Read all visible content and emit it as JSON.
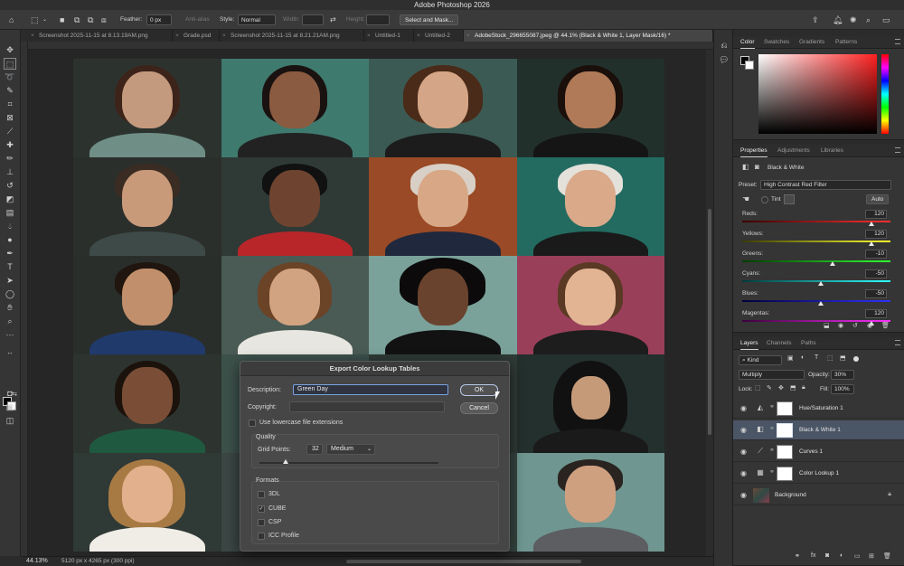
{
  "app": {
    "title": "Adobe Photoshop 2026"
  },
  "options_bar": {
    "feather_label": "Feather:",
    "feather_value": "0 px",
    "antialias_label": "Anti-alias",
    "style_label": "Style:",
    "style_value": "Normal",
    "width_label": "Width:",
    "height_label": "Height:",
    "select_mask_label": "Select and Mask..."
  },
  "doc_tabs": [
    {
      "label": "Screenshot 2025-11-15 at 8.13.19AM.png"
    },
    {
      "label": "Grade.psd"
    },
    {
      "label": "Screenshot 2025-11-15 at 8.21.21AM.png"
    },
    {
      "label": "Untitled-1"
    },
    {
      "label": "Untitled-2"
    },
    {
      "label": "AdobeStock_296655087.jpeg @ 44.1% (Black & White 1, Layer Mask/16) *"
    }
  ],
  "status": {
    "zoom": "44.13%",
    "info": "5120 px x 4265 px (300 ppi)"
  },
  "color_panel": {
    "tabs": [
      "Color",
      "Swatches",
      "Gradients",
      "Patterns"
    ],
    "foreground": "#000000",
    "background": "#ffffff"
  },
  "properties": {
    "tabs": [
      "Properties",
      "Adjustments",
      "Libraries"
    ],
    "adjustment_name": "Black & White",
    "preset_label": "Preset:",
    "preset_value": "High Contrast Red Filter",
    "tint_label": "Tint",
    "auto_label": "Auto",
    "sliders": [
      {
        "label": "Reds:",
        "value": "120",
        "pos": 0.87
      },
      {
        "label": "Yellows:",
        "value": "120",
        "pos": 0.87
      },
      {
        "label": "Greens:",
        "value": "-10",
        "pos": 0.61
      },
      {
        "label": "Cyans:",
        "value": "-50",
        "pos": 0.53
      },
      {
        "label": "Blues:",
        "value": "-50",
        "pos": 0.53
      },
      {
        "label": "Magentas:",
        "value": "120",
        "pos": 0.87
      }
    ]
  },
  "layers_panel": {
    "tabs": [
      "Layers",
      "Channels",
      "Paths"
    ],
    "filter_value": "Kind",
    "blend_mode": "Multiply",
    "opacity_label": "Opacity:",
    "opacity_value": "30%",
    "lock_label": "Lock:",
    "fill_label": "Fill:",
    "fill_value": "100%",
    "layers": [
      {
        "name": "Hue/Saturation 1",
        "selected": false
      },
      {
        "name": "Black & White 1",
        "selected": true
      },
      {
        "name": "Curves 1",
        "selected": false
      },
      {
        "name": "Color Lookup 1",
        "selected": false
      },
      {
        "name": "Background",
        "selected": false
      }
    ]
  },
  "dialog": {
    "title": "Export Color Lookup Tables",
    "description_label": "Description:",
    "description_value": "Green Day",
    "copyright_label": "Copyright:",
    "copyright_value": "",
    "ok_label": "OK",
    "cancel_label": "Cancel",
    "lowercase_label": "Use lowercase file extensions",
    "lowercase_checked": false,
    "quality_label": "Quality",
    "grid_points_label": "Grid Points:",
    "grid_points_value": "32",
    "grid_quality_value": "Medium",
    "formats_label": "Formats",
    "formats": [
      {
        "label": "3DL",
        "checked": false
      },
      {
        "label": "CUBE",
        "checked": true
      },
      {
        "label": "CSP",
        "checked": false
      },
      {
        "label": "ICC Profile",
        "checked": false
      }
    ]
  }
}
